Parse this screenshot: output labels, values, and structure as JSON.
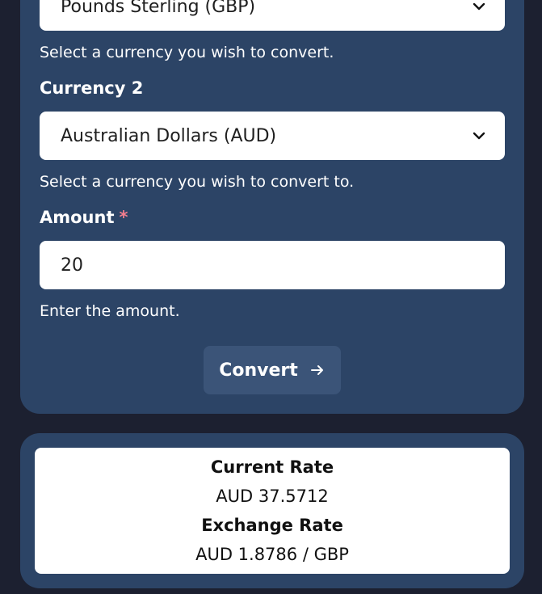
{
  "form": {
    "currency1": {
      "selected": "Pounds Sterling (GBP)",
      "help": "Select a currency you wish to convert."
    },
    "currency2": {
      "label": "Currency 2",
      "selected": "Australian Dollars (AUD)",
      "help": "Select a currency you wish to convert to."
    },
    "amount": {
      "label": "Amount",
      "required_marker": "*",
      "value": "20",
      "help": "Enter the amount."
    },
    "convert_label": "Convert"
  },
  "result": {
    "current_rate_label": "Current Rate",
    "current_rate_value": "AUD 37.5712",
    "exchange_rate_label": "Exchange Rate",
    "exchange_rate_value": "AUD 1.8786 / GBP"
  },
  "icons": {
    "dropdown": "chevron-down-icon",
    "convert": "arrow-right-icon"
  },
  "colors": {
    "page_bg": "#1c2030",
    "card_bg": "#2c4466",
    "button_bg": "#3b5478",
    "required": "#f47e8e"
  }
}
